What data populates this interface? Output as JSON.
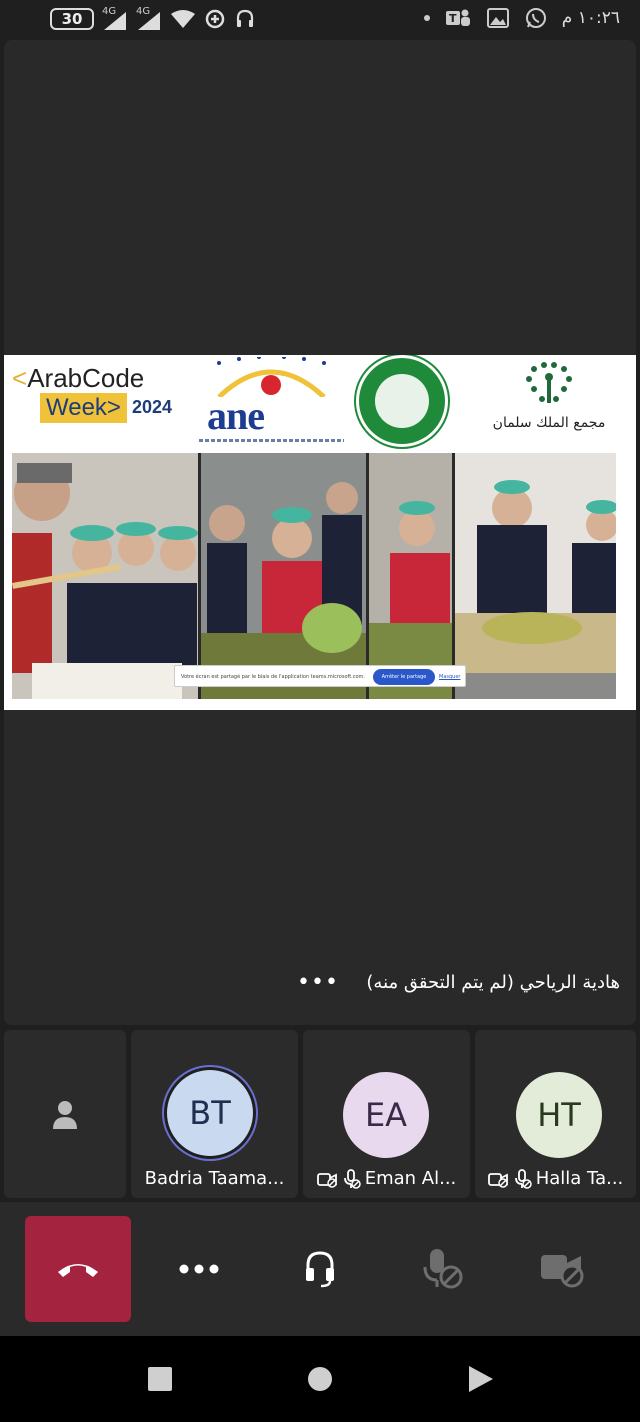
{
  "status_bar": {
    "battery": "30",
    "signal1_label": "4G",
    "signal2_label": "4G",
    "time": "١٠:٢٦ م"
  },
  "shared_screen": {
    "arab_code_week": {
      "line1": "ArabCode",
      "lt": "<",
      "week": "Week>",
      "year": "2024"
    },
    "ane_logo": "ane",
    "ksa_text": "مجمع الملك سلمان",
    "notice": {
      "text": "Votre écran est partagé par le biais de l'application teams.microsoft.com.",
      "stop_button": "Arrêter le partage",
      "hide_link": "Masquer"
    }
  },
  "presenter": {
    "name": "هادية الرياحي (لم يتم التحقق منه)",
    "more_label": "•••"
  },
  "participants": [
    {
      "initials": "BT",
      "name": "Badria Taama...",
      "avatar_bg": "#c9d9f0",
      "avatar_fg": "#1f2f4f",
      "ring": "#6b6fd1"
    },
    {
      "initials": "EA",
      "name": "Eman Al...",
      "avatar_bg": "#e8d9ef",
      "avatar_fg": "#3a2a4a"
    },
    {
      "initials": "HT",
      "name": "Halla Ta...",
      "avatar_bg": "#e3ecd8",
      "avatar_fg": "#2a3a1f"
    }
  ],
  "controls": {
    "hangup_color": "#a4233e"
  }
}
